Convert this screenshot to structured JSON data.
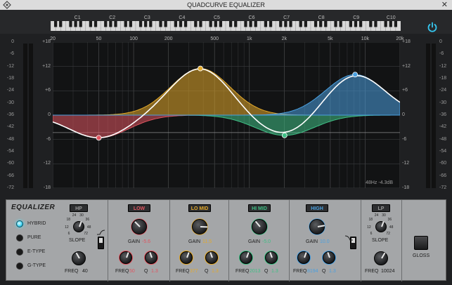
{
  "window": {
    "title": "QUADCURVE EQUALIZER",
    "close_glyph": "✕"
  },
  "notes": [
    "C1",
    "C2",
    "C3",
    "C4",
    "C5",
    "C6",
    "C7",
    "C8",
    "C9",
    "C10"
  ],
  "freq_labels": [
    "20",
    "50",
    "100",
    "200",
    "500",
    "1k",
    "2k",
    "5k",
    "10k",
    "20k"
  ],
  "db_left": [
    "+18",
    "+12",
    "+6",
    "0",
    "-6",
    "-12",
    "-18"
  ],
  "db_right": [
    "+18",
    "+12",
    "+6",
    "0",
    "-6",
    "-12",
    "-18"
  ],
  "meter_scale": [
    "0",
    "-6",
    "-12",
    "-18",
    "-24",
    "-30",
    "-36",
    "-42",
    "-48",
    "-54",
    "-60",
    "-66",
    "-72"
  ],
  "readout": "48Hz  -4.3dB",
  "eq_label": "EQUALIZER",
  "modes": [
    {
      "label": "HYBRID",
      "active": true
    },
    {
      "label": "PURE",
      "active": false
    },
    {
      "label": "E-TYPE",
      "active": false
    },
    {
      "label": "G-TYPE",
      "active": false
    }
  ],
  "hp": {
    "label": "HP",
    "slope_label": "SLOPE",
    "freq_label": "FREQ",
    "freq_value": "40",
    "slope_ticks": [
      "6",
      "12",
      "18",
      "24",
      "30",
      "36",
      "48",
      "72"
    ]
  },
  "lp": {
    "label": "LP",
    "slope_label": "SLOPE",
    "freq_label": "FREQ",
    "freq_value": "10024",
    "slope_ticks": [
      "6",
      "12",
      "18",
      "24",
      "30",
      "36",
      "48",
      "72"
    ]
  },
  "bands": [
    {
      "key": "low",
      "label": "LOW",
      "color": "#e05560",
      "gain_label": "GAIN",
      "gain_value": "-5.6",
      "freq_label": "FREQ",
      "freq_value": "50",
      "q_label": "Q",
      "q_value": "1.3"
    },
    {
      "key": "lomid",
      "label": "LO MID",
      "color": "#e3a92a",
      "gain_label": "GAIN",
      "gain_value": "11.5",
      "freq_label": "FREQ",
      "freq_value": "377",
      "q_label": "Q",
      "q_value": "1.3"
    },
    {
      "key": "himid",
      "label": "HI MID",
      "color": "#3fbf85",
      "gain_label": "GAIN",
      "gain_value": "-5.0",
      "freq_label": "FREQ",
      "freq_value": "2013",
      "q_label": "Q",
      "q_value": "1.3"
    },
    {
      "key": "high",
      "label": "HIGH",
      "color": "#4aa0e0",
      "gain_label": "GAIN",
      "gain_value": "10.0",
      "freq_label": "FREQ",
      "freq_value": "8194",
      "q_label": "Q",
      "q_value": "1.3"
    }
  ],
  "gloss_label": "GLOSS"
}
